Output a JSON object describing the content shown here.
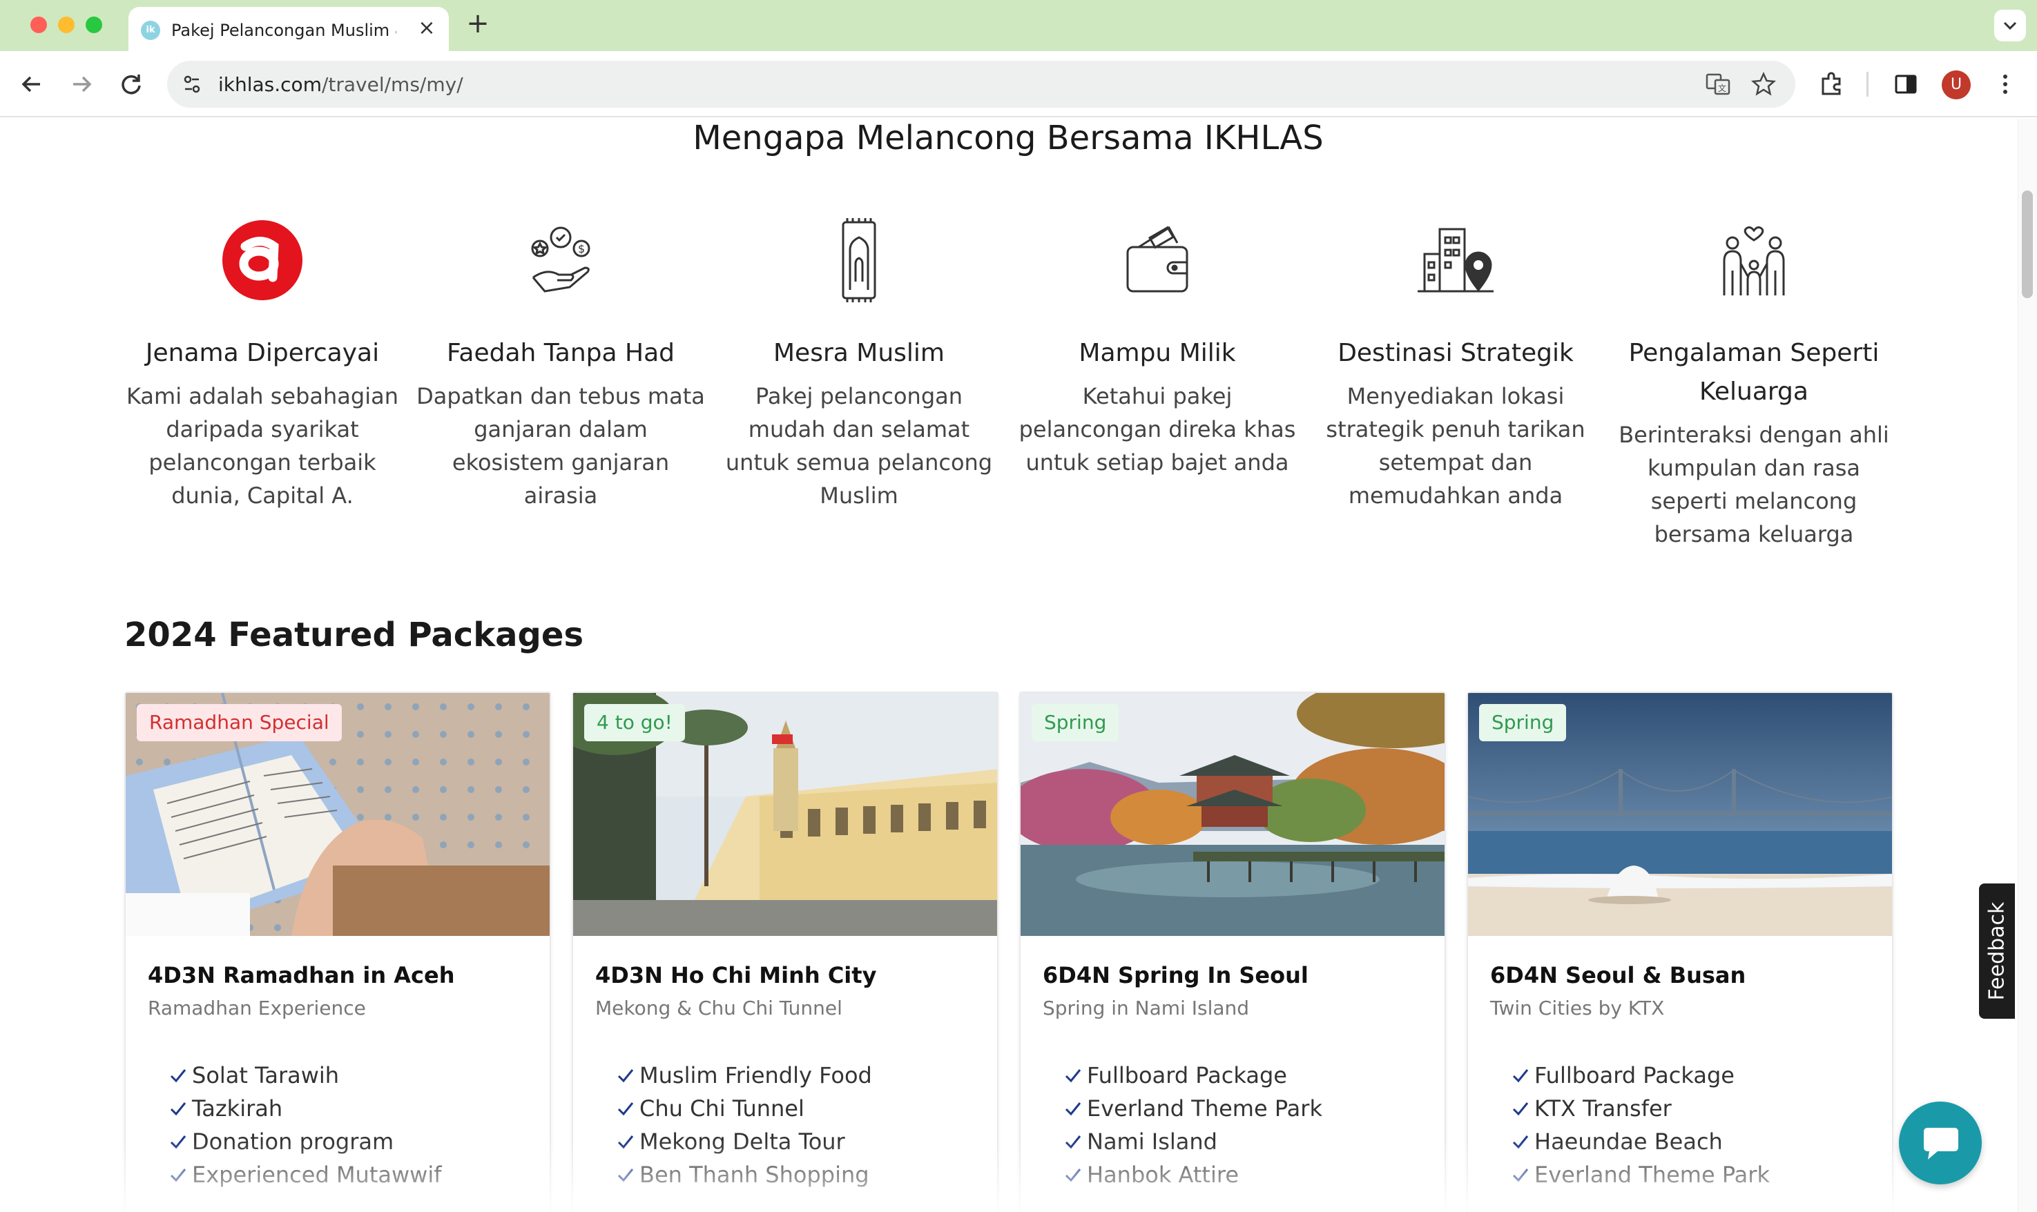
{
  "browser": {
    "tab_title": "Pakej Pelancongan Muslim & I",
    "url_domain": "ikhlas.com",
    "url_path": "/travel/ms/my/",
    "avatar_letter": "U"
  },
  "why_section": {
    "title": "Mengapa Melancong Bersama IKHLAS",
    "features": [
      {
        "title": "Jenama Dipercayai",
        "desc": "Kami adalah sebahagian daripada syarikat pelancongan terbaik dunia, Capital A.",
        "icon": "airasia-logo-icon"
      },
      {
        "title": "Faedah Tanpa Had",
        "desc": "Dapatkan dan tebus mata ganjaran dalam ekosistem ganjaran airasia",
        "icon": "rewards-hand-icon"
      },
      {
        "title": "Mesra Muslim",
        "desc": "Pakej pelancongan mudah dan selamat untuk semua pelancong Muslim",
        "icon": "prayer-mat-icon"
      },
      {
        "title": "Mampu Milik",
        "desc": "Ketahui pakej pelancongan direka khas untuk setiap bajet anda",
        "icon": "wallet-icon"
      },
      {
        "title": "Destinasi Strategik",
        "desc": "Menyediakan lokasi strategik penuh tarikan setempat dan memudahkan anda",
        "icon": "building-location-icon"
      },
      {
        "title": "Pengalaman Seperti Keluarga",
        "desc": "Berinteraksi dengan ahli kumpulan dan rasa seperti melancong bersama keluarga",
        "icon": "family-icon"
      }
    ]
  },
  "featured": {
    "title": "2024 Featured Packages",
    "cards": [
      {
        "badge": "Ramadhan Special",
        "badge_color": "#d32f2f",
        "title": "4D3N Ramadhan in Aceh",
        "subtitle": "Ramadhan Experience",
        "items": [
          "Solat Tarawih",
          "Tazkirah",
          "Donation program",
          "Experienced Mutawwif"
        ]
      },
      {
        "badge": "4 to go!",
        "badge_color": "#2e9b4f",
        "title": "4D3N Ho Chi Minh City",
        "subtitle": "Mekong & Chu Chi Tunnel",
        "items": [
          "Muslim Friendly Food",
          "Chu Chi Tunnel",
          "Mekong Delta Tour",
          "Ben Thanh Shopping"
        ]
      },
      {
        "badge": "Spring",
        "badge_color": "#2e9b4f",
        "title": "6D4N Spring In Seoul",
        "subtitle": "Spring in Nami Island",
        "items": [
          "Fullboard Package",
          "Everland Theme Park",
          "Nami Island",
          "Hanbok Attire"
        ]
      },
      {
        "badge": "Spring",
        "badge_color": "#2e9b4f",
        "title": "6D4N Seoul & Busan",
        "subtitle": "Twin Cities by KTX",
        "items": [
          "Fullboard Package",
          "KTX Transfer",
          "Haeundae Beach",
          "Everland Theme Park"
        ]
      }
    ]
  },
  "feedback_label": "Feedback",
  "colors": {
    "brand_red": "#e3141d",
    "check_blue": "#1e3a8a",
    "chat_teal": "#1a9aa8"
  }
}
